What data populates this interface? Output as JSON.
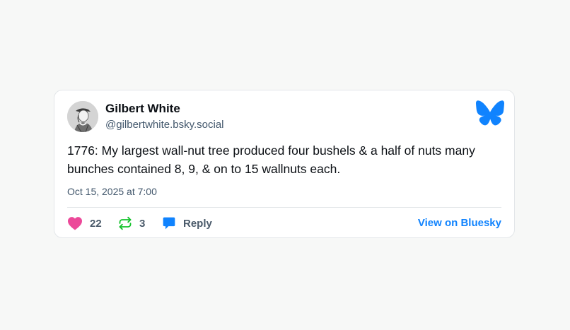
{
  "post": {
    "author_name": "Gilbert White",
    "author_handle": "@gilbertwhite.bsky.social",
    "text": "1776: My largest wall-nut tree produced four bushels & a half of nuts many bunches contained 8, 9, & on to 15 wallnuts each.",
    "timestamp": "Oct 15, 2025 at 7:00"
  },
  "actions": {
    "likes": "22",
    "reposts": "3",
    "reply_label": "Reply",
    "view_label": "View on Bluesky"
  },
  "icons": {
    "like": "heart-icon",
    "repost": "repost-icon",
    "reply": "speech-bubble-icon",
    "brand": "bluesky-butterfly-icon"
  },
  "colors": {
    "brand": "#1083fe",
    "like": "#ec4899",
    "repost": "#13c22b",
    "reply": "#1083fe",
    "text_primary": "#0b0f14",
    "text_secondary": "#42576c"
  }
}
